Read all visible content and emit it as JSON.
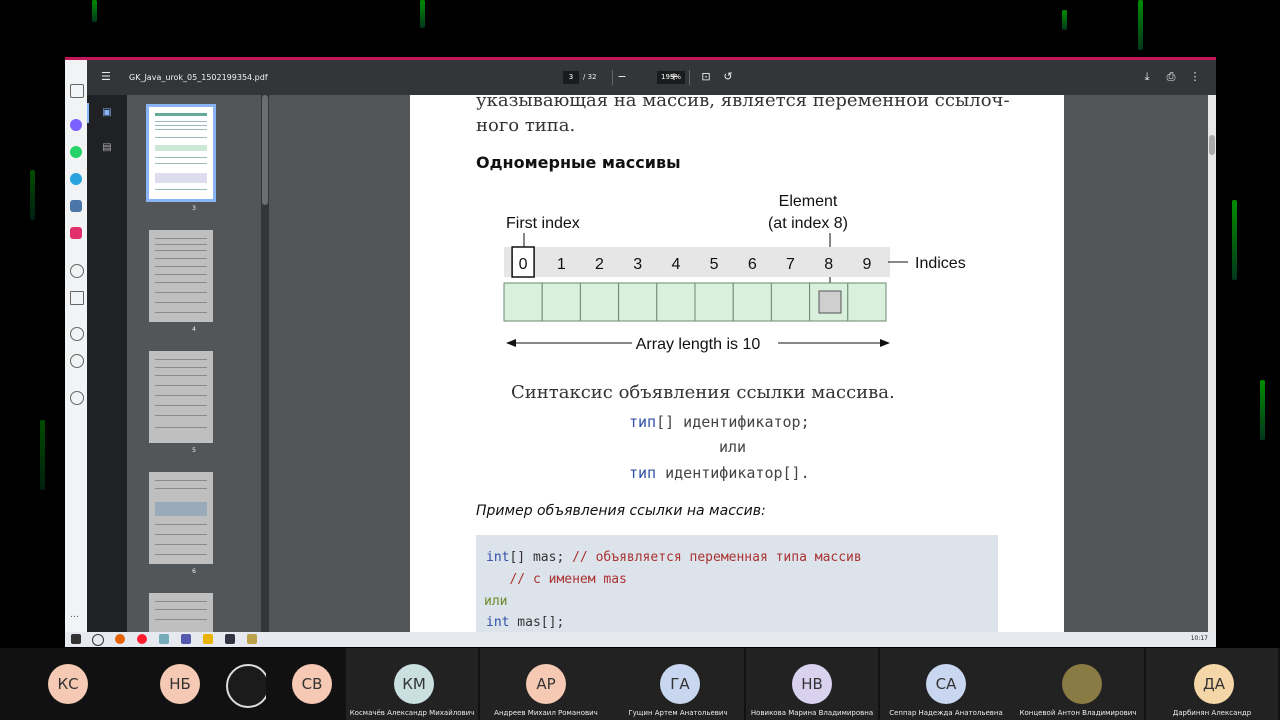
{
  "window": {
    "file_name": "GK_Java_urok_05_1502199354.pdf",
    "current_page": "3",
    "page_count": "/ 32",
    "zoom": "195%",
    "time": "10:17"
  },
  "sidebar": {
    "thumbnails": [
      {
        "label": "3"
      },
      {
        "label": "4"
      },
      {
        "label": "5"
      },
      {
        "label": "6"
      }
    ]
  },
  "document": {
    "intro_line1": "указывающая на массив, является переменной ссылоч-",
    "intro_line2": "ного типа.",
    "heading": "Одномерные массивы",
    "diagram": {
      "first_index_label": "First index",
      "element_label_1": "Element",
      "element_label_2": "(at index 8)",
      "indices": [
        "0",
        "1",
        "2",
        "3",
        "4",
        "5",
        "6",
        "7",
        "8",
        "9"
      ],
      "indices_label": "Indices",
      "length_label": "Array length is 10"
    },
    "syntax_title": "Синтаксис объявления ссылки массива.",
    "syntax1_type": "тип",
    "syntax1_rest": "[] идентификатор;",
    "syntax_or": "или",
    "syntax2_type": "тип",
    "syntax2_rest": " идентификатор[].",
    "example_heading": "Пример объявления ссылки на массив:",
    "code": {
      "l1_kw": "int",
      "l1_decl": "[] mas; ",
      "l1_comment": "// объявляется переменная типа массив",
      "l2_comment": "   // с именем mas",
      "l3_or": "или",
      "l4_kw": "int",
      "l4_decl": " mas[];"
    }
  },
  "participants": [
    {
      "initials": "КС",
      "name": "",
      "color": "#f5c9b3"
    },
    {
      "initials": "НБ",
      "name": "",
      "color": "#f5c9b3"
    },
    {
      "initials": "",
      "name": "",
      "color": "#1b1b1b"
    },
    {
      "initials": "СВ",
      "name": "",
      "color": "#f5c9b3"
    },
    {
      "initials": "КМ",
      "name": "Космачёв Александр Михайлович",
      "color": "#c9dfe0"
    },
    {
      "initials": "АР",
      "name": "Андреев Михаил Романович",
      "color": "#f5c9b3"
    },
    {
      "initials": "ГА",
      "name": "Гущин Артем Анатольевич",
      "color": "#c8d7ef"
    },
    {
      "initials": "НВ",
      "name": "Новикова Марина Владимировна",
      "color": "#d9d2ef"
    },
    {
      "initials": "СА",
      "name": "Сеппар Надежда Анатольевна",
      "color": "#c8d7ef"
    },
    {
      "initials": "",
      "name": "Концевой Антон Владимирович",
      "color": "#8a7a44"
    },
    {
      "initials": "ДА",
      "name": "Дарбинян Александр",
      "color": "#f5d6a8"
    }
  ]
}
